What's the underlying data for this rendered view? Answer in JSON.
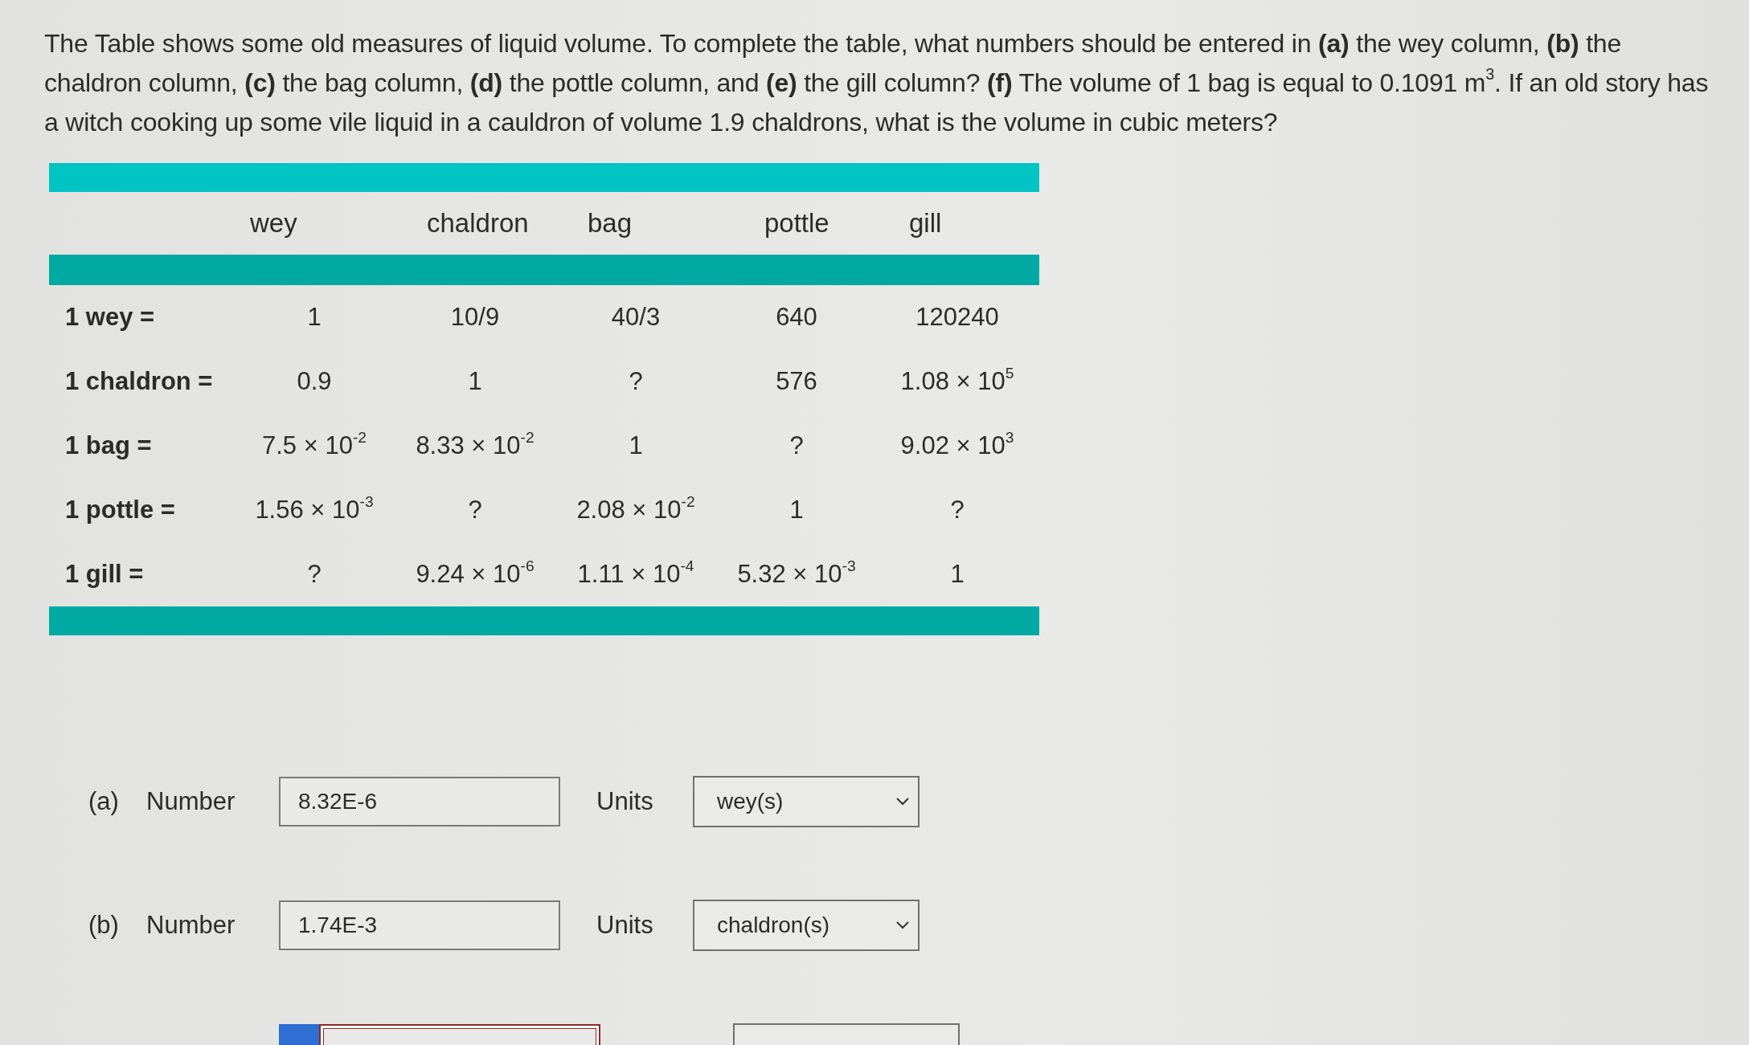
{
  "question": "The Table shows some old measures of liquid volume. To complete the table, what numbers should be entered in **(a)** the wey column, **(b)** the chaldron column, **(c)** the bag column, **(d)** the pottle column, and **(e)** the gill column? **(f)** The volume of 1 bag is equal to 0.1091 m$^{3}$. If an old story has a witch cooking up some vile liquid in a cauldron of volume 1.9 chaldrons, what is the volume in cubic meters?",
  "table": {
    "columns": [
      "wey",
      "chaldron",
      "bag",
      "pottle",
      "gill"
    ],
    "rows": [
      {
        "label": "1 wey =",
        "cells": [
          "1",
          "10/9",
          "40/3",
          "640",
          "120240"
        ]
      },
      {
        "label": "1 chaldron =",
        "cells": [
          "0.9",
          "1",
          "?",
          "576",
          "1.08 × 10$^{5}$"
        ]
      },
      {
        "label": "1 bag =",
        "cells": [
          "7.5 × 10$^{-2}$",
          "8.33 × 10$^{-2}$",
          "1",
          "?",
          "9.02 × 10$^{3}$"
        ]
      },
      {
        "label": "1 pottle =",
        "cells": [
          "1.56 × 10$^{-3}$",
          "?",
          "2.08 × 10$^{-2}$",
          "1",
          "?"
        ]
      },
      {
        "label": "1 gill =",
        "cells": [
          "?",
          "9.24 × 10$^{-6}$",
          "1.11 × 10$^{-4}$",
          "5.32 × 10$^{-3}$",
          "1"
        ]
      }
    ]
  },
  "answers": [
    {
      "part": "(a)",
      "number_label": "Number",
      "value": "8.32E-6",
      "units_label": "Units",
      "unit": "wey(s)",
      "flagged": false,
      "info": false
    },
    {
      "part": "(b)",
      "number_label": "Number",
      "value": "1.74E-3",
      "units_label": "Units",
      "unit": "chaldron(s)",
      "flagged": false,
      "info": false
    },
    {
      "flagged": true,
      "info": true
    }
  ]
}
